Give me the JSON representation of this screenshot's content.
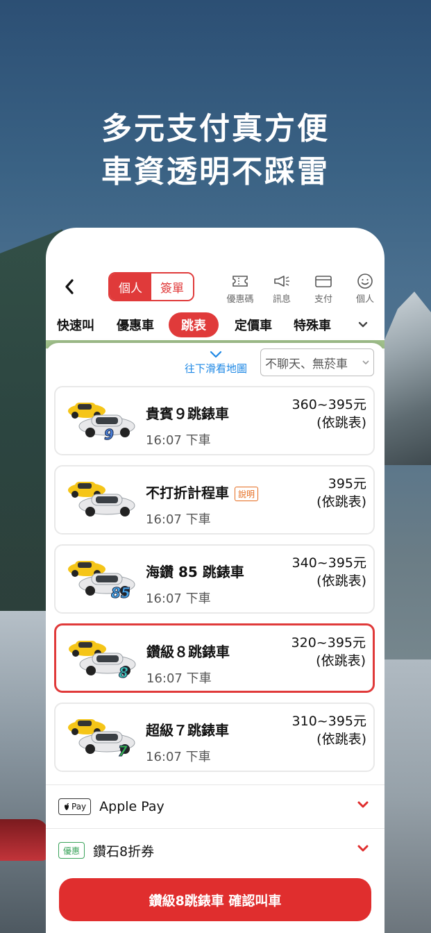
{
  "headline": {
    "line1": "多元支付真方便",
    "line2": "車資透明不踩雷"
  },
  "topbar": {
    "segments": [
      {
        "label": "個人",
        "active": true
      },
      {
        "label": "簽單",
        "active": false
      }
    ],
    "icons": [
      {
        "name": "ticket-icon",
        "label": "優惠碼"
      },
      {
        "name": "megaphone-icon",
        "label": "訊息"
      },
      {
        "name": "card-icon",
        "label": "支付"
      },
      {
        "name": "smiley-icon",
        "label": "個人"
      }
    ]
  },
  "categories": [
    {
      "label": "快速叫",
      "active": false
    },
    {
      "label": "優惠車",
      "active": false
    },
    {
      "label": "跳表",
      "active": true
    },
    {
      "label": "定價車",
      "active": false
    },
    {
      "label": "特殊車",
      "active": false
    }
  ],
  "scroll_hint": "往下滑看地圖",
  "filter": {
    "value": "不聊天、無菸車"
  },
  "cards": [
    {
      "name": "貴賓９跳錶車",
      "time": "16:07 下車",
      "price": "360~395元",
      "note": "(依跳表)",
      "badge": "9",
      "badge_color": "#4a7fd8",
      "selected": false
    },
    {
      "name": "不打折計程車",
      "time": "16:07 下車",
      "price": "395元",
      "note": "(依跳表)",
      "badge": "",
      "explain": "說明",
      "selected": false
    },
    {
      "name": "海鑽 85 跳錶車",
      "time": "16:07 下車",
      "price": "340~395元",
      "note": "(依跳表)",
      "badge": "85",
      "badge_color": "#49a6e8",
      "selected": false
    },
    {
      "name": "鑽級８跳錶車",
      "time": "16:07 下車",
      "price": "320~395元",
      "note": "(依跳表)",
      "badge": "8",
      "badge_color": "#3ec7b6",
      "selected": true
    },
    {
      "name": "超級７跳錶車",
      "time": "16:07 下車",
      "price": "310~395元",
      "note": "(依跳表)",
      "badge": "7",
      "badge_color": "#37b54a",
      "selected": false
    }
  ],
  "payment": {
    "badge": "Pay",
    "label": "Apple Pay"
  },
  "promo": {
    "badge": "優惠",
    "label": "鑽石8折券"
  },
  "cta_label": "鑽級8跳錶車 確認叫車",
  "colors": {
    "accent": "#e03a3a",
    "link": "#1e88e5"
  }
}
